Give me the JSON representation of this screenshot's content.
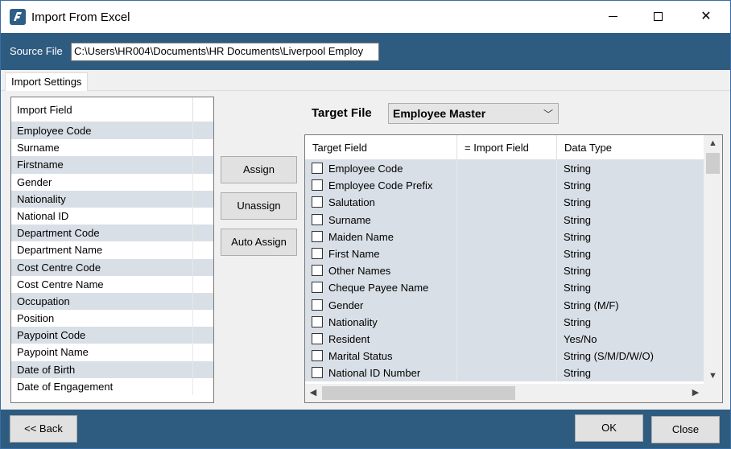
{
  "window": {
    "title": "Import From Excel",
    "minimize_icon": "minimize-icon",
    "maximize_icon": "maximize-icon",
    "close_icon": "close-icon",
    "close_glyph": "✕"
  },
  "source": {
    "label": "Source File",
    "value": "C:\\Users\\HR004\\Documents\\HR Documents\\Liverpool Employ"
  },
  "tabs": [
    {
      "label": "Import Settings"
    }
  ],
  "import_list": {
    "header": "Import Field",
    "items": [
      "Employee Code",
      "Surname",
      "Firstname",
      "Gender",
      "Nationality",
      "National ID",
      "Department Code",
      "Department Name",
      "Cost Centre Code",
      "Cost Centre Name",
      "Occupation",
      "Position",
      "Paypoint Code",
      "Paypoint Name",
      "Date of Birth",
      "Date of Engagement"
    ]
  },
  "actions": {
    "assign": "Assign",
    "unassign": "Unassign",
    "auto_assign": "Auto Assign"
  },
  "target": {
    "label": "Target File",
    "selected": "Employee Master",
    "chevron": "﹀"
  },
  "grid": {
    "columns": [
      "Target Field",
      "= Import Field",
      "Data Type"
    ],
    "rows": [
      {
        "field": "Employee Code",
        "import": "",
        "type": "String"
      },
      {
        "field": "Employee Code Prefix",
        "import": "",
        "type": "String"
      },
      {
        "field": "Salutation",
        "import": "",
        "type": "String"
      },
      {
        "field": "Surname",
        "import": "",
        "type": "String"
      },
      {
        "field": "Maiden Name",
        "import": "",
        "type": "String"
      },
      {
        "field": "First Name",
        "import": "",
        "type": "String"
      },
      {
        "field": "Other Names",
        "import": "",
        "type": "String"
      },
      {
        "field": "Cheque Payee Name",
        "import": "",
        "type": "String"
      },
      {
        "field": "Gender",
        "import": "",
        "type": "String (M/F)"
      },
      {
        "field": "Nationality",
        "import": "",
        "type": "String"
      },
      {
        "field": "Resident",
        "import": "",
        "type": "Yes/No"
      },
      {
        "field": "Marital Status",
        "import": "",
        "type": "String  (S/M/D/W/O)"
      },
      {
        "field": "National ID Number",
        "import": "",
        "type": "String"
      }
    ],
    "scroll": {
      "up": "▲",
      "down": "▼",
      "left": "◀",
      "right": "▶"
    }
  },
  "footer": {
    "back": "<< Back",
    "ok": "OK",
    "close": "Close"
  },
  "colors": {
    "accent_bar": "#2e5b80",
    "row_shade": "#d9dfe6"
  }
}
